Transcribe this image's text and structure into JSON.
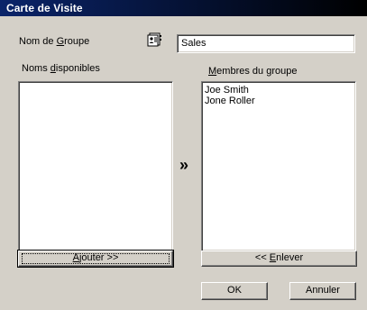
{
  "window": {
    "title": "Carte de Visite"
  },
  "group": {
    "name_label_pre": "Nom de ",
    "name_label_key": "G",
    "name_label_post": "roupe",
    "name_value": "Sales",
    "icon": "address-book-icon"
  },
  "available": {
    "label_pre": "Noms ",
    "label_key": "d",
    "label_post": "isponibles",
    "items": [],
    "add_button_pre": "",
    "add_button_key": "A",
    "add_button_post": "jouter >>"
  },
  "members": {
    "label_pre": "",
    "label_key": "M",
    "label_post": "embres du groupe",
    "items": [
      "Joe Smith",
      "Jone Roller"
    ],
    "remove_button_pre": "<< ",
    "remove_button_key": "E",
    "remove_button_post": "nlever"
  },
  "transfer_icon": "»",
  "buttons": {
    "ok": "OK",
    "cancel": "Annuler"
  }
}
